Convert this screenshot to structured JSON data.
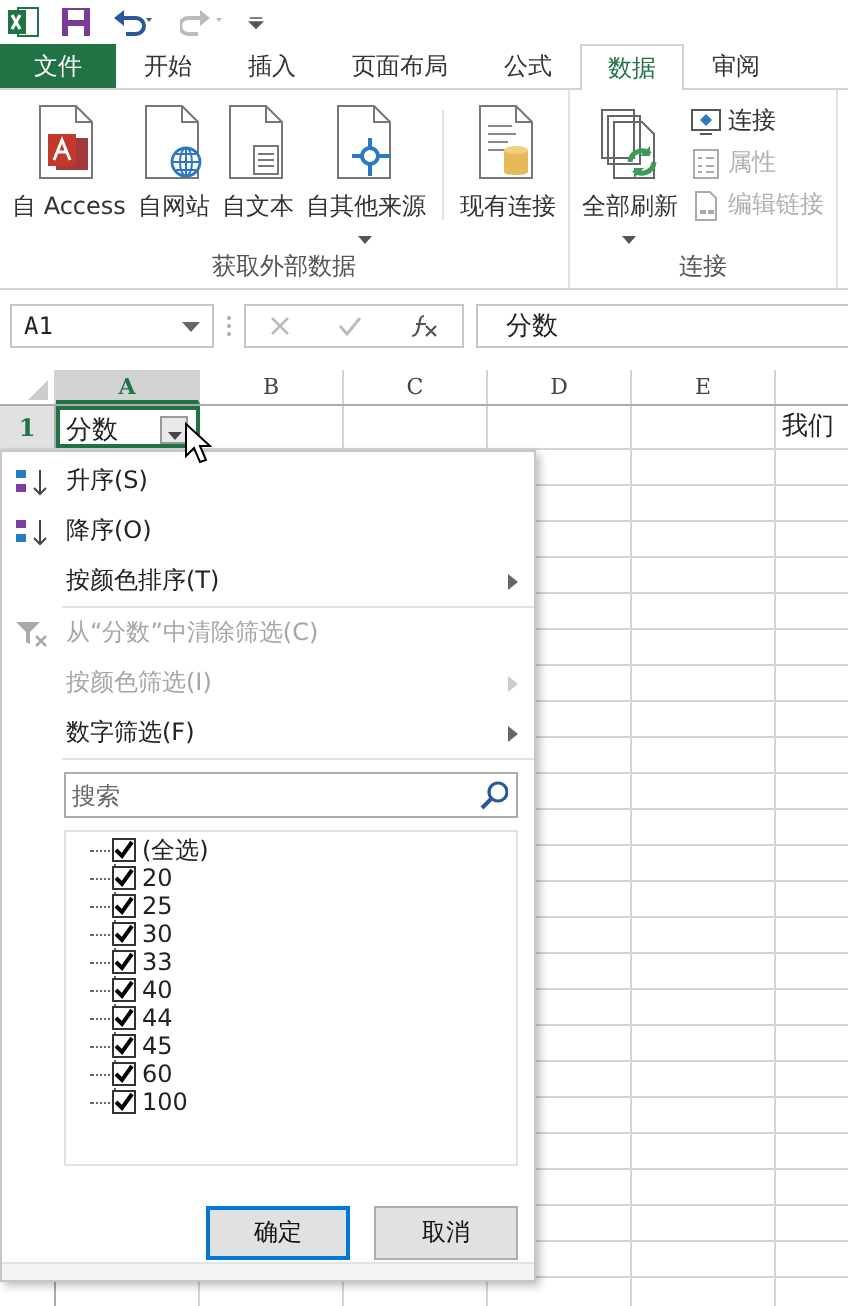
{
  "ribbon_tabs": [
    {
      "label": "文件",
      "kind": "file",
      "selected": false
    },
    {
      "label": "开始",
      "kind": "tab",
      "selected": false
    },
    {
      "label": "插入",
      "kind": "tab",
      "selected": false
    },
    {
      "label": "页面布局",
      "kind": "tab",
      "selected": false
    },
    {
      "label": "公式",
      "kind": "tab",
      "selected": false
    },
    {
      "label": "数据",
      "kind": "tab",
      "selected": true
    },
    {
      "label": "审阅",
      "kind": "tab",
      "selected": false
    }
  ],
  "ribbon_groups": [
    {
      "label": "获取外部数据",
      "commands": [
        {
          "label": "自 Access",
          "kind": "access",
          "dropdown": false
        },
        {
          "label": "自网站",
          "kind": "web",
          "dropdown": false
        },
        {
          "label": "自文本",
          "kind": "text",
          "dropdown": false
        },
        {
          "label": "自其他来源",
          "kind": "other",
          "dropdown": true
        },
        {
          "label": "现有连接",
          "kind": "existing",
          "dropdown": false,
          "separator_before": true
        }
      ]
    },
    {
      "label": "连接",
      "commands": [
        {
          "label": "全部刷新",
          "kind": "refresh",
          "dropdown": true
        }
      ],
      "small_commands": [
        {
          "label": "连接",
          "kind": "connections",
          "disabled": false
        },
        {
          "label": "属性",
          "kind": "properties",
          "disabled": true
        },
        {
          "label": "编辑链接",
          "kind": "links",
          "disabled": true
        }
      ]
    }
  ],
  "name_box": {
    "value": "A1"
  },
  "formula_bar": {
    "value": "分数"
  },
  "sheet": {
    "columns": [
      {
        "label": "A",
        "selected": true
      },
      {
        "label": "B",
        "selected": false
      },
      {
        "label": "C",
        "selected": false
      },
      {
        "label": "D",
        "selected": false
      },
      {
        "label": "E",
        "selected": false
      }
    ],
    "rows": [
      {
        "label": "1",
        "selected": true,
        "cell_a": {
          "value": "分数",
          "filter": true
        },
        "column_6_cell": {
          "value": "我们"
        }
      }
    ]
  },
  "filter_menu": {
    "items": [
      {
        "label": "升序(S)",
        "kind": "sort_asc",
        "disabled": false,
        "submenu": false
      },
      {
        "label": "降序(O)",
        "kind": "sort_desc",
        "disabled": false,
        "submenu": false
      },
      {
        "label": "按颜色排序(T)",
        "kind": "plain",
        "disabled": false,
        "submenu": true
      },
      {
        "label": "从“分数”中清除筛选(C)",
        "kind": "clear_filter",
        "disabled": true,
        "submenu": false,
        "separator_before": true
      },
      {
        "label": "按颜色筛选(I)",
        "kind": "plain",
        "disabled": true,
        "submenu": true
      },
      {
        "label": "数字筛选(F)",
        "kind": "plain",
        "disabled": false,
        "submenu": true
      }
    ],
    "search": {
      "placeholder": "搜索"
    },
    "values": [
      {
        "label": "(全选)",
        "checked": true
      },
      {
        "label": "20",
        "checked": true
      },
      {
        "label": "25",
        "checked": true
      },
      {
        "label": "30",
        "checked": true
      },
      {
        "label": "33",
        "checked": true
      },
      {
        "label": "40",
        "checked": true
      },
      {
        "label": "44",
        "checked": true
      },
      {
        "label": "45",
        "checked": true
      },
      {
        "label": "60",
        "checked": true
      },
      {
        "label": "100",
        "checked": true
      }
    ],
    "buttons": [
      {
        "label": "确定",
        "default": true
      },
      {
        "label": "取消",
        "default": false
      }
    ]
  }
}
